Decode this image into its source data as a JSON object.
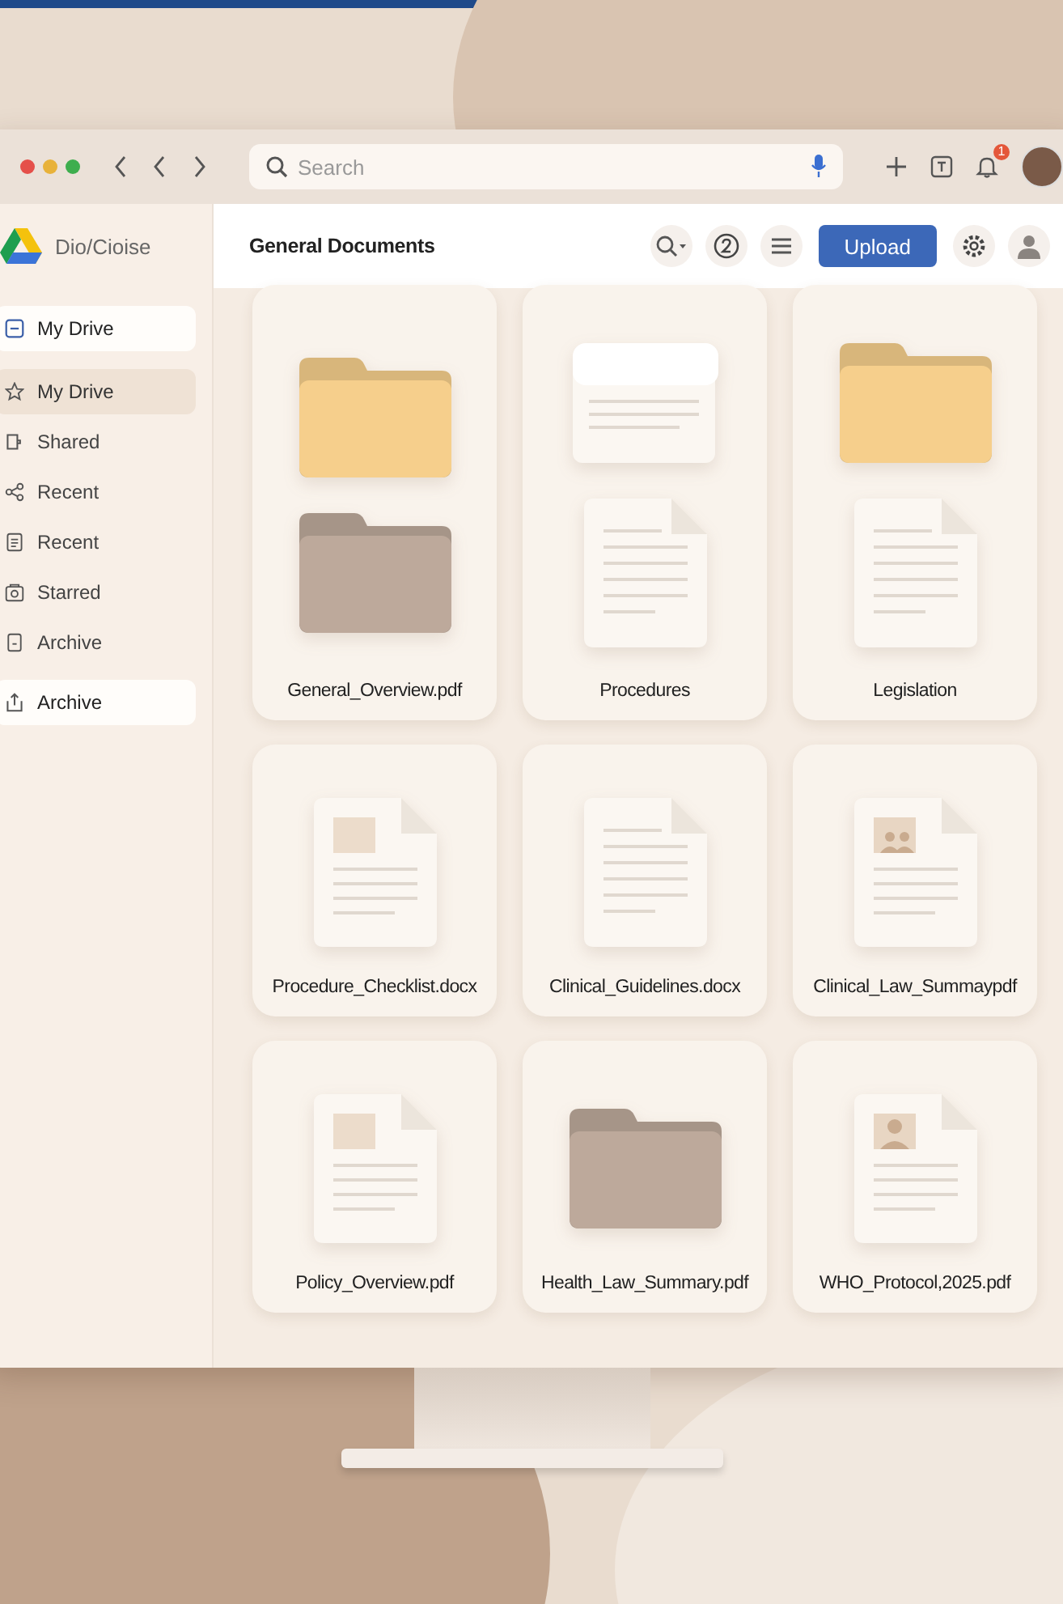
{
  "browser": {
    "search": {
      "placeholder": "Search"
    },
    "notification_count": "1"
  },
  "app": {
    "brand": "Dio/Cioise",
    "title": "General Documents",
    "upload_button": "Upload"
  },
  "sidebar": {
    "items": [
      {
        "label": "My Drive",
        "kind": "pinned",
        "selected": false
      },
      {
        "label": "My Drive",
        "kind": "nav",
        "selected": true
      },
      {
        "label": "Shared",
        "kind": "nav",
        "selected": false
      },
      {
        "label": "Recent",
        "kind": "nav",
        "selected": false
      },
      {
        "label": "Recent",
        "kind": "nav",
        "selected": false
      },
      {
        "label": "Starred",
        "kind": "nav",
        "selected": false
      },
      {
        "label": "Archive",
        "kind": "nav",
        "selected": false
      },
      {
        "label": "Archive",
        "kind": "pinned",
        "selected": false
      }
    ]
  },
  "files": [
    {
      "name": "General_Overview.pdf",
      "icons": [
        {
          "kind": "folder",
          "color": "#f6cf8c"
        },
        {
          "kind": "folder",
          "color": "#bda99b"
        }
      ]
    },
    {
      "name": "Procedures",
      "icons": [
        {
          "kind": "scroll"
        },
        {
          "kind": "document"
        }
      ]
    },
    {
      "name": "Legislation",
      "icons": [
        {
          "kind": "folder",
          "color": "#f6cf8c"
        },
        {
          "kind": "document"
        }
      ]
    },
    {
      "name": "Procedure_Checklist.docx",
      "icons": [
        {
          "kind": "image-document"
        }
      ]
    },
    {
      "name": "Clinical_Guidelines.docx",
      "icons": [
        {
          "kind": "document"
        }
      ]
    },
    {
      "name": "Clinical_Law_Summaypdf",
      "icons": [
        {
          "kind": "photo-document"
        }
      ]
    },
    {
      "name": "Policy_Overview.pdf",
      "icons": [
        {
          "kind": "image-document"
        }
      ]
    },
    {
      "name": "Health_Law_Summary.pdf",
      "icons": [
        {
          "kind": "folder",
          "color": "#bda99b"
        }
      ]
    },
    {
      "name": "WHO_Protocol,2025.pdf",
      "icons": [
        {
          "kind": "person-document"
        }
      ]
    }
  ]
}
